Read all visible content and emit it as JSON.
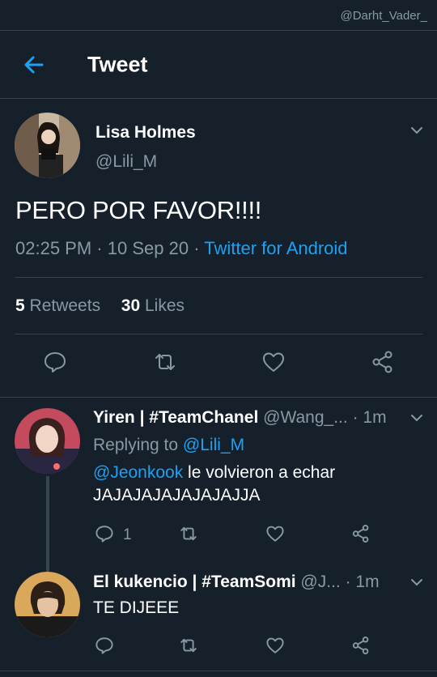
{
  "watermark": "@Darht_Vader_",
  "header": {
    "title": "Tweet"
  },
  "main_tweet": {
    "name": "Lisa Holmes",
    "handle": "@Lili_M",
    "text": "PERO POR FAVOR!!!!",
    "time": "02:25 PM",
    "date": "10 Sep 20",
    "source": "Twitter for Android",
    "retweets_count": "5",
    "retweets_label": "Retweets",
    "likes_count": "30",
    "likes_label": "Likes"
  },
  "replies": [
    {
      "name": "Yiren | #TeamChanel",
      "handle": "@Wang_...",
      "time": "1m",
      "replying_prefix": "Replying to",
      "replying_to": "@Lili_M",
      "mention": "@Jeonkook",
      "text_after_mention": " le volvieron a echar",
      "text_line2": "JAJAJAJAJAJAJAJJA",
      "reply_count": "1"
    },
    {
      "name": "El kukencio | #TeamSomi",
      "handle": "@J...",
      "time": "1m",
      "text": "TE DIJEEE"
    }
  ],
  "colors": {
    "background": "#15202b",
    "accent": "#1da1f2",
    "muted": "#8899a6",
    "divider": "#38444d"
  }
}
